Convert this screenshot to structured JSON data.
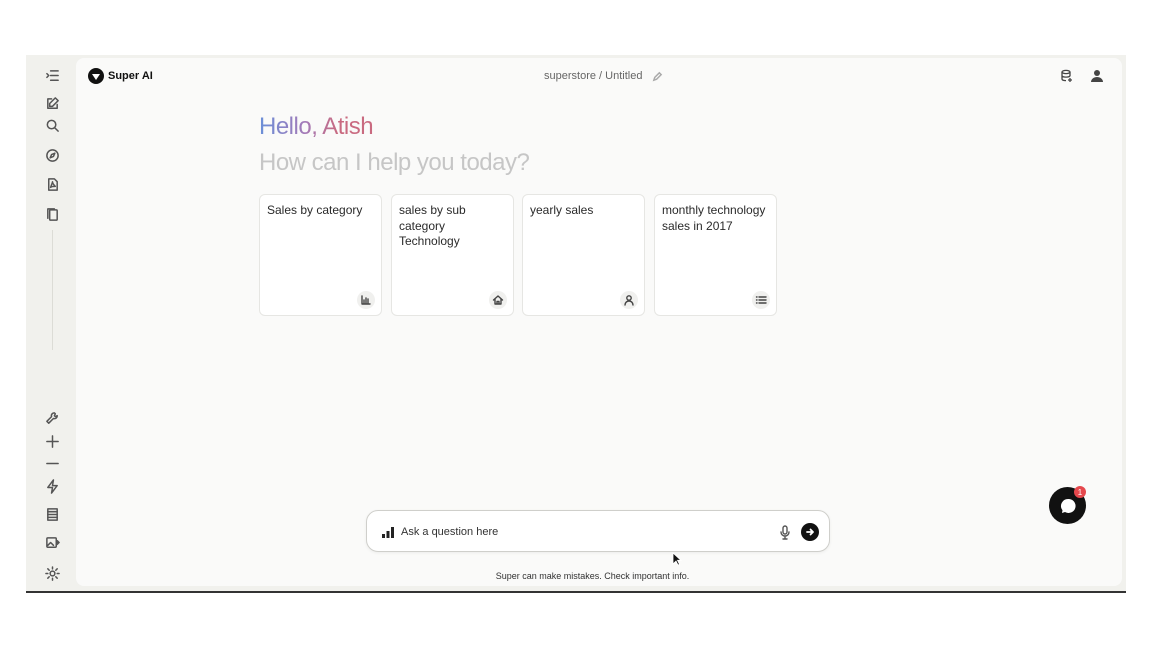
{
  "app": {
    "name": "Super AI"
  },
  "header": {
    "breadcrumb": "superstore / Untitled"
  },
  "welcome": {
    "greeting": "Hello, Atish",
    "subtitle": "How can I help you today?"
  },
  "suggestions": [
    {
      "label": "Sales by category",
      "icon": "bar-chart-icon"
    },
    {
      "label": "sales by sub category Technology",
      "icon": "home-icon"
    },
    {
      "label": "yearly sales",
      "icon": "person-icon"
    },
    {
      "label": "monthly technology sales in 2017",
      "icon": "list-icon"
    }
  ],
  "ask": {
    "placeholder": "Ask a question here"
  },
  "footer": {
    "disclaimer": "Super can make mistakes. Check important info."
  },
  "chat_widget": {
    "badge": "1"
  },
  "colors": {
    "accent_blue": "#6a8fd8",
    "accent_rose": "#c96a80",
    "badge_red": "#e5484d",
    "dark": "#111111"
  },
  "sidebar_icons": [
    "collapse-sidebar-icon",
    "new-chat-icon",
    "search-icon",
    "explore-icon",
    "pdf-file-icon",
    "copy-icon",
    "wrench-icon",
    "plus-icon",
    "minus-icon",
    "lightning-icon",
    "table-icon",
    "image-export-icon",
    "settings-icon"
  ]
}
